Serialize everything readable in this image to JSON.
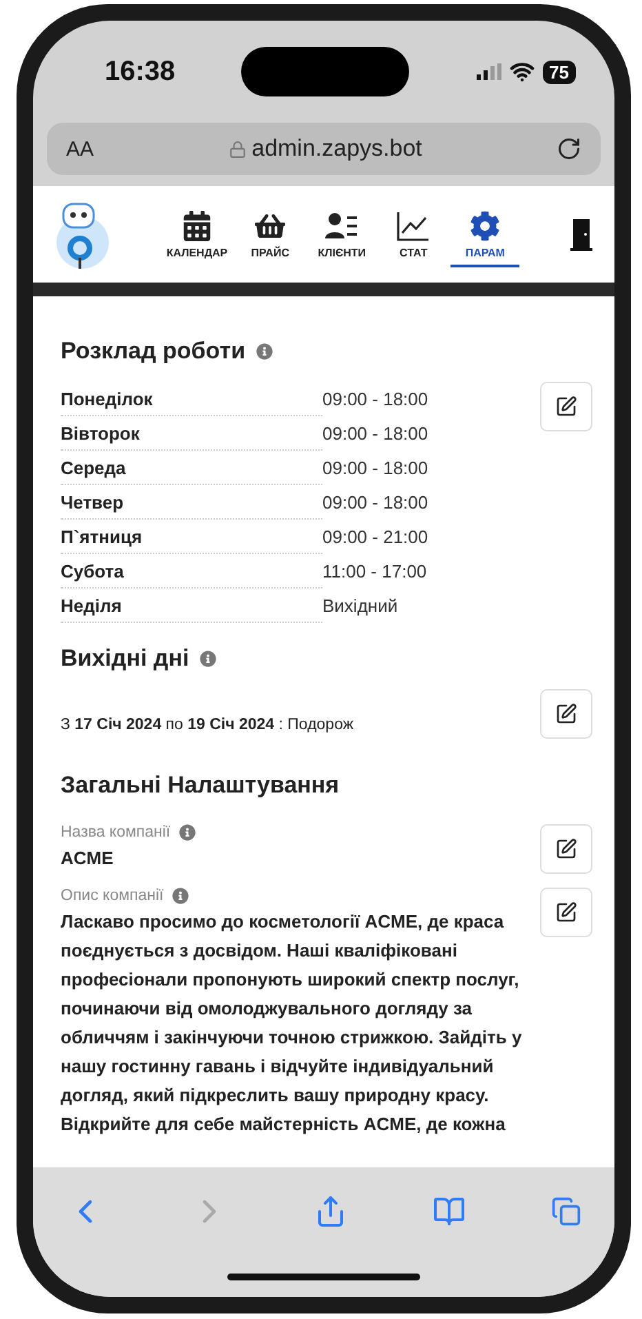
{
  "status_bar": {
    "time": "16:38",
    "battery": "75"
  },
  "browser": {
    "text_size": "AA",
    "url": "admin.zapys.bot"
  },
  "nav": {
    "tabs": [
      {
        "kind": "calendar",
        "label": "КАЛЕНДАР",
        "selected": false
      },
      {
        "kind": "price",
        "label": "ПРАЙС",
        "selected": false
      },
      {
        "kind": "clients",
        "label": "КЛІЄНТИ",
        "selected": false
      },
      {
        "kind": "stats",
        "label": "СТАТ",
        "selected": false
      },
      {
        "kind": "settings",
        "label": "ПАРАМ",
        "selected": true
      }
    ]
  },
  "schedule": {
    "title": "Розклад роботи",
    "rows": [
      {
        "day": "Понеділок",
        "hours": "09:00 - 18:00"
      },
      {
        "day": "Вівторок",
        "hours": "09:00 - 18:00"
      },
      {
        "day": "Середа",
        "hours": "09:00 - 18:00"
      },
      {
        "day": "Четвер",
        "hours": "09:00 - 18:00"
      },
      {
        "day": "П`ятниця",
        "hours": "09:00 - 21:00"
      },
      {
        "day": "Субота",
        "hours": "11:00 - 17:00"
      },
      {
        "day": "Неділя",
        "hours": "Вихідний"
      }
    ]
  },
  "days_off": {
    "title": "Вихідні дні",
    "entries": [
      "З **17 Січ 2024** по **19 Січ 2024** : Подорож"
    ]
  },
  "general": {
    "title": "Загальні Налаштування",
    "fields": [
      {
        "label": "Назва компанії",
        "value": "ACME"
      },
      {
        "label": "Опис компанії",
        "value": "Ласкаво просимо до косметології ACME, де краса поєднується з досвідом. Наші кваліфіковані професіонали пропонують широкий спектр послуг, починаючи від омолоджувального догляду за обличчям і закінчуючи точною стрижкою. Зайдіть у нашу гостинну гавань і відчуйте індивідуальний догляд, який підкреслить вашу природну красу. Відкрийте для себе майстерність ACME, де кожна"
      }
    ]
  }
}
